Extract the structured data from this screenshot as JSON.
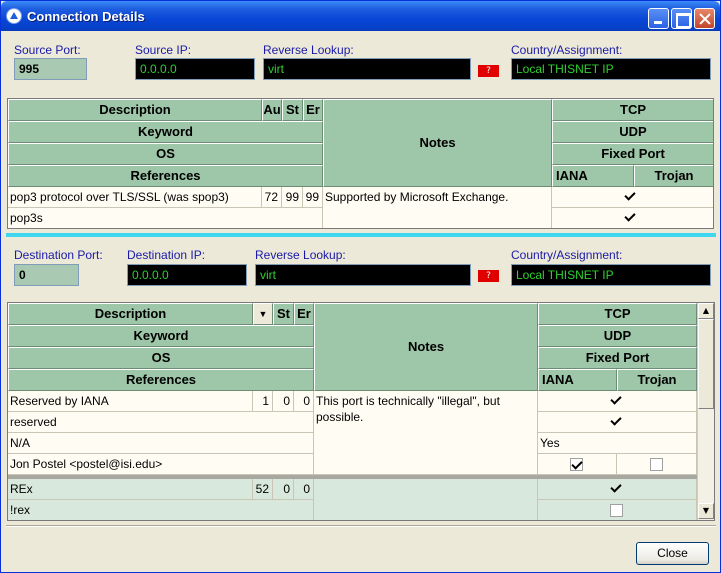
{
  "window": {
    "title": "Connection Details",
    "buttons": {
      "minimize": "_",
      "maximize": "□",
      "close": "×"
    },
    "close_button": "Close"
  },
  "source": {
    "port_label": "Source Port:",
    "port_value": "995",
    "ip_label": "Source IP:",
    "ip_value": "0.0.0.0",
    "reverse_label": "Reverse Lookup:",
    "reverse_value": "virt",
    "help": "?",
    "country_label": "Country/Assignment:",
    "country_value": "Local THISNET IP",
    "headers": {
      "description": "Description",
      "col_a": "Au",
      "col_st": "St",
      "col_er": "Er",
      "keyword": "Keyword",
      "os": "OS",
      "references": "References",
      "notes": "Notes",
      "tcp": "TCP",
      "udp": "UDP",
      "fixed_port": "Fixed Port",
      "iana": "IANA",
      "trojan": "Trojan"
    },
    "rows": {
      "description": "pop3 protocol over TLS/SSL (was spop3)",
      "au": "72",
      "st": "99",
      "er": "99",
      "keyword": "pop3s",
      "notes": "Supported by Microsoft Exchange.",
      "tcp_checked": true,
      "udp_checked": true
    }
  },
  "destination": {
    "port_label": "Destination Port:",
    "port_value": "0",
    "ip_label": "Destination IP:",
    "ip_value": "0.0.0.0",
    "reverse_label": "Reverse Lookup:",
    "reverse_value": "virt",
    "help": "?",
    "country_label": "Country/Assignment:",
    "country_value": "Local THISNET IP",
    "headers": {
      "description": "Description",
      "col_st": "St",
      "col_er": "Er",
      "keyword": "Keyword",
      "os": "OS",
      "references": "References",
      "notes": "Notes",
      "tcp": "TCP",
      "udp": "UDP",
      "fixed_port": "Fixed Port",
      "iana": "IANA",
      "trojan": "Trojan"
    },
    "record1": {
      "description": "Reserved by IANA",
      "v1": "1",
      "v2": "0",
      "v3": "0",
      "keyword": "reserved",
      "os": "N/A",
      "references": "Jon Postel <postel@isi.edu>",
      "notes": "This port is technically \"illegal\", but possible.",
      "tcp_checked": true,
      "udp_checked": true,
      "fixed_port": "Yes",
      "iana_checked": true,
      "trojan_checked": false
    },
    "record2": {
      "description": "REx",
      "v1": "52",
      "v2": "0",
      "v3": "0",
      "keyword": "!rex",
      "tcp_checked": true,
      "udp_checked": false
    }
  }
}
